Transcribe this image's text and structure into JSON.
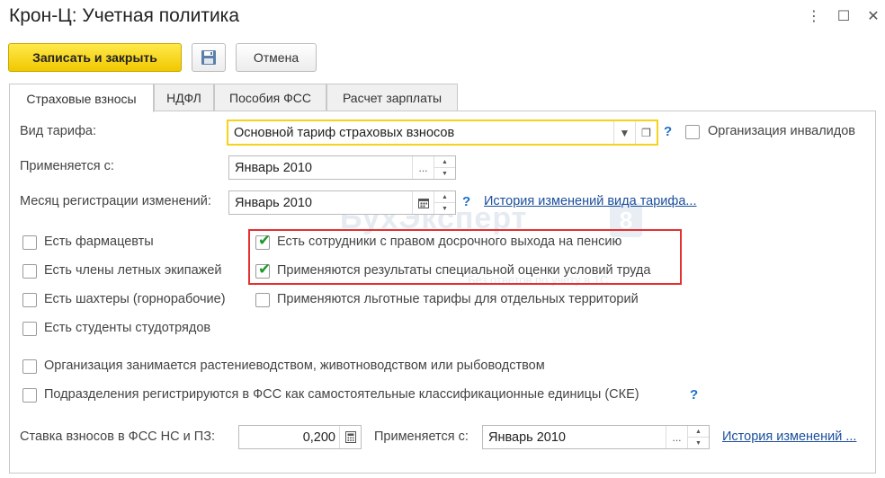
{
  "window": {
    "title": "Крон-Ц: Учетная политика",
    "controls": [
      "⋮",
      "☐",
      "✕"
    ]
  },
  "toolbar": {
    "save_close_label": "Записать и закрыть",
    "cancel_label": "Отмена"
  },
  "tabs": [
    {
      "label": "Страховые взносы",
      "active": true
    },
    {
      "label": "НДФЛ",
      "active": false
    },
    {
      "label": "Пособия ФСС",
      "active": false
    },
    {
      "label": "Расчет зарплаты",
      "active": false
    }
  ],
  "tariff": {
    "label": "Вид тарифа:",
    "value": "Основной тариф страховых взносов",
    "help": "?"
  },
  "invalids": {
    "label": "Организация инвалидов",
    "checked": false
  },
  "applies_from": {
    "label": "Применяется с:",
    "value": "Январь 2010"
  },
  "reg_month": {
    "label": "Месяц регистрации изменений:",
    "value": "Январь 2010",
    "help": "?",
    "history_link": "История изменений вида тарифа..."
  },
  "watermark": {
    "brand": "БухЭксперт",
    "digit": "8",
    "sub": "Без ответов по учету в 1С"
  },
  "left_checks": [
    {
      "label": "Есть фармацевты",
      "checked": false
    },
    {
      "label": "Есть члены летных экипажей",
      "checked": false
    },
    {
      "label": "Есть шахтеры (горнорабочие)",
      "checked": false
    },
    {
      "label": "Есть студенты студотрядов",
      "checked": false
    }
  ],
  "right_checks": [
    {
      "label": "Есть сотрудники с правом досрочного выхода на пенсию",
      "checked": true
    },
    {
      "label": "Применяются результаты специальной оценки условий труда",
      "checked": true
    },
    {
      "label": "Применяются льготные тарифы для отдельных территорий",
      "checked": false
    }
  ],
  "wide_checks": [
    {
      "label": "Организация занимается растениеводством, животноводством или рыбоводством",
      "checked": false
    },
    {
      "label": "Подразделения регистрируются в ФСС как самостоятельные классификационные единицы (СКЕ)",
      "checked": false,
      "help": "?"
    }
  ],
  "fss_rate": {
    "label": "Ставка взносов в ФСС НС и ПЗ:",
    "value": "0,200",
    "applies_label": "Применяется с:",
    "applies_value": "Январь 2010",
    "history_link": "История изменений ..."
  },
  "colors": {
    "accent_yellow": "#f5d21b",
    "link": "#1b4f9c",
    "check": "#1a9a2a",
    "highlight": "#e53030"
  }
}
